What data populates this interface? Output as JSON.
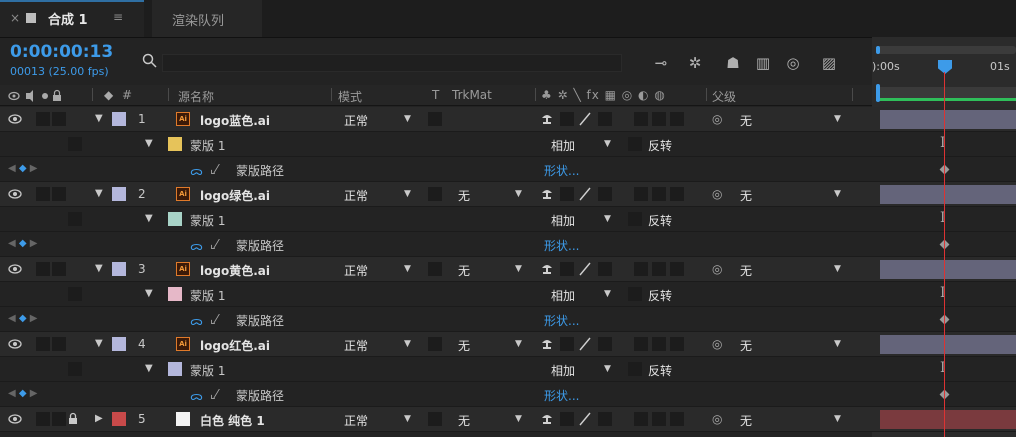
{
  "tabs": {
    "comp_tab": {
      "close": "×",
      "title": "合成 1",
      "menu": "≡"
    },
    "render_tab": {
      "title": "渲染队列"
    }
  },
  "controls": {
    "timecode": "0:00:00:13",
    "frames": "00013 (25.00 fps)",
    "search_placeholder": ""
  },
  "timeline": {
    "ruler_start": "):00s",
    "ruler_end": "01s"
  },
  "columns": {
    "num": "#",
    "source_name": "源名称",
    "mode": "模式",
    "t": "T",
    "trkmat": "TrkMat",
    "parent": "父级"
  },
  "layers": [
    {
      "num": "1",
      "name": "logo蓝色.ai",
      "color": "#b4b7dc",
      "mode": "正常",
      "trkmat": "",
      "parent_pick": "◎",
      "parent": "无",
      "mask": {
        "name": "蒙版 1",
        "color": "#e6c35a",
        "mode": "相加",
        "invert": "反转",
        "path": "蒙版路径",
        "shape": "形状..."
      }
    },
    {
      "num": "2",
      "name": "logo绿色.ai",
      "color": "#b4b7dc",
      "mode": "正常",
      "trkmat": "无",
      "parent_pick": "◎",
      "parent": "无",
      "mask": {
        "name": "蒙版 1",
        "color": "#a8d3c7",
        "mode": "相加",
        "invert": "反转",
        "path": "蒙版路径",
        "shape": "形状..."
      }
    },
    {
      "num": "3",
      "name": "logo黄色.ai",
      "color": "#b4b7dc",
      "mode": "正常",
      "trkmat": "无",
      "parent_pick": "◎",
      "parent": "无",
      "mask": {
        "name": "蒙版 1",
        "color": "#e6b8c8",
        "mode": "相加",
        "invert": "反转",
        "path": "蒙版路径",
        "shape": "形状..."
      }
    },
    {
      "num": "4",
      "name": "logo红色.ai",
      "color": "#b4b7dc",
      "mode": "正常",
      "trkmat": "无",
      "parent_pick": "◎",
      "parent": "无",
      "mask": {
        "name": "蒙版 1",
        "color": "#b4b7dc",
        "mode": "相加",
        "invert": "反转",
        "path": "蒙版路径",
        "shape": "形状..."
      }
    }
  ],
  "solid_layer": {
    "num": "5",
    "name": "白色 纯色 1",
    "color": "#c84a4a",
    "mode": "正常",
    "trkmat": "无",
    "parent_pick": "◎",
    "parent": "无"
  },
  "icons": {
    "ai_badge": "Ai",
    "stopwatch": "ᯅ",
    "graph": "⌇",
    "switches_header": "♣ ✲ ╲ fx ▦ ◎ ◐ ◍"
  },
  "colors": {
    "accent_blue": "#3d9be9",
    "current_time_indicator": "#dd3333",
    "layer_bar": "#64647a",
    "solid_bar": "#7a3a3e",
    "workarea_green": "#2fbf5a"
  }
}
